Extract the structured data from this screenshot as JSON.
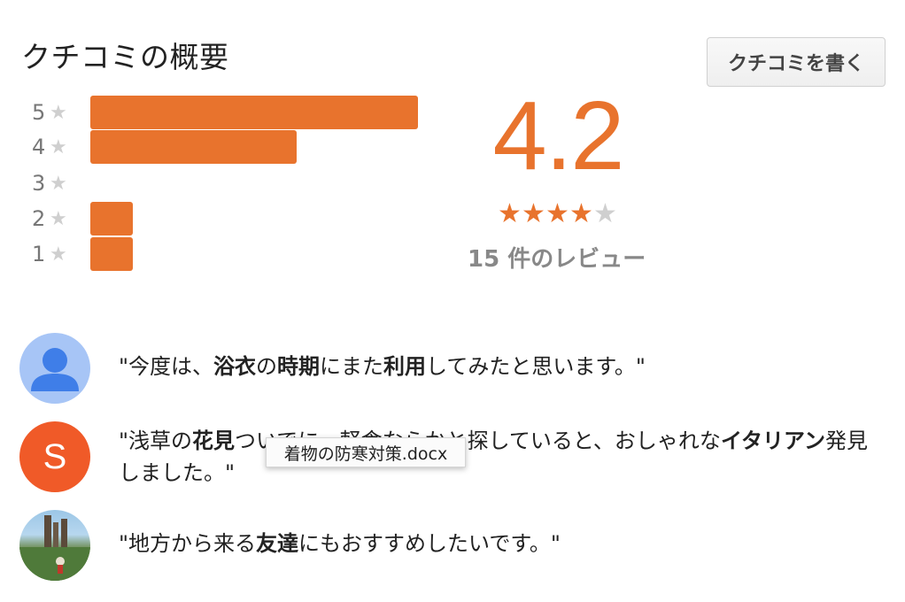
{
  "header": {
    "title": "クチコミの概要",
    "write_button": "クチコミを書く"
  },
  "histogram": {
    "rows": [
      {
        "stars": "5",
        "fraction": 1.0
      },
      {
        "stars": "4",
        "fraction": 0.63
      },
      {
        "stars": "3",
        "fraction": 0.0
      },
      {
        "stars": "2",
        "fraction": 0.13
      },
      {
        "stars": "1",
        "fraction": 0.13
      }
    ],
    "star_glyph": "★",
    "bar_color": "#e8732d"
  },
  "summary": {
    "rating": "4.2",
    "stars_filled": 4,
    "stars_total": 5,
    "filled_color": "#e8732d",
    "empty_color": "#cfcfcf",
    "count_text": "15 件のレビュー"
  },
  "reviews": [
    {
      "avatar": "person-icon",
      "segments": [
        {
          "t": "\"今度は、",
          "b": false
        },
        {
          "t": "浴衣",
          "b": true
        },
        {
          "t": "の",
          "b": false
        },
        {
          "t": "時期",
          "b": true
        },
        {
          "t": "にまた",
          "b": false
        },
        {
          "t": "利用",
          "b": true
        },
        {
          "t": "してみたと思います。\"",
          "b": false
        }
      ]
    },
    {
      "avatar": "S",
      "segments": [
        {
          "t": "\"浅草の",
          "b": false
        },
        {
          "t": "花見",
          "b": true
        },
        {
          "t": "ついでに、軽食ならかと探していると、おしゃれな",
          "b": false
        },
        {
          "t": "イタリアン",
          "b": true
        },
        {
          "t": "発見しました。\"",
          "b": false
        }
      ]
    },
    {
      "avatar": "photo",
      "segments": [
        {
          "t": "\"地方から来る",
          "b": false
        },
        {
          "t": "友達",
          "b": true
        },
        {
          "t": "にもおすすめしたいです。\"",
          "b": false
        }
      ]
    }
  ],
  "tooltip": {
    "text": "着物の防寒対策.docx"
  }
}
